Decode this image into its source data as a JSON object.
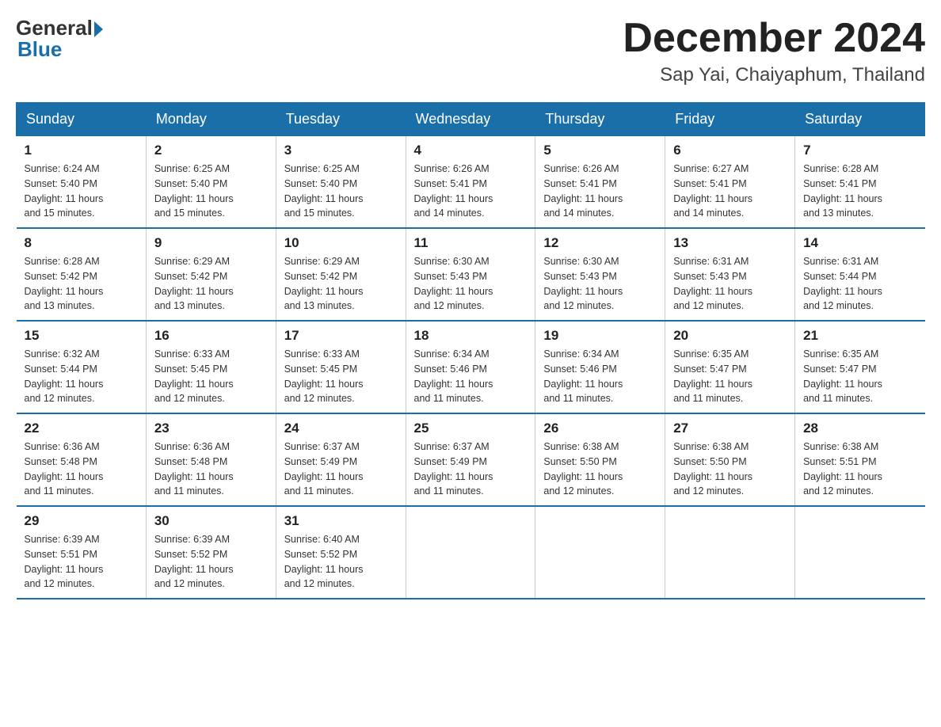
{
  "header": {
    "logo_general": "General",
    "logo_blue": "Blue",
    "month_title": "December 2024",
    "subtitle": "Sap Yai, Chaiyaphum, Thailand"
  },
  "days_of_week": [
    "Sunday",
    "Monday",
    "Tuesday",
    "Wednesday",
    "Thursday",
    "Friday",
    "Saturday"
  ],
  "weeks": [
    [
      {
        "day": "1",
        "sunrise": "6:24 AM",
        "sunset": "5:40 PM",
        "daylight": "11 hours and 15 minutes."
      },
      {
        "day": "2",
        "sunrise": "6:25 AM",
        "sunset": "5:40 PM",
        "daylight": "11 hours and 15 minutes."
      },
      {
        "day": "3",
        "sunrise": "6:25 AM",
        "sunset": "5:40 PM",
        "daylight": "11 hours and 15 minutes."
      },
      {
        "day": "4",
        "sunrise": "6:26 AM",
        "sunset": "5:41 PM",
        "daylight": "11 hours and 14 minutes."
      },
      {
        "day": "5",
        "sunrise": "6:26 AM",
        "sunset": "5:41 PM",
        "daylight": "11 hours and 14 minutes."
      },
      {
        "day": "6",
        "sunrise": "6:27 AM",
        "sunset": "5:41 PM",
        "daylight": "11 hours and 14 minutes."
      },
      {
        "day": "7",
        "sunrise": "6:28 AM",
        "sunset": "5:41 PM",
        "daylight": "11 hours and 13 minutes."
      }
    ],
    [
      {
        "day": "8",
        "sunrise": "6:28 AM",
        "sunset": "5:42 PM",
        "daylight": "11 hours and 13 minutes."
      },
      {
        "day": "9",
        "sunrise": "6:29 AM",
        "sunset": "5:42 PM",
        "daylight": "11 hours and 13 minutes."
      },
      {
        "day": "10",
        "sunrise": "6:29 AM",
        "sunset": "5:42 PM",
        "daylight": "11 hours and 13 minutes."
      },
      {
        "day": "11",
        "sunrise": "6:30 AM",
        "sunset": "5:43 PM",
        "daylight": "11 hours and 12 minutes."
      },
      {
        "day": "12",
        "sunrise": "6:30 AM",
        "sunset": "5:43 PM",
        "daylight": "11 hours and 12 minutes."
      },
      {
        "day": "13",
        "sunrise": "6:31 AM",
        "sunset": "5:43 PM",
        "daylight": "11 hours and 12 minutes."
      },
      {
        "day": "14",
        "sunrise": "6:31 AM",
        "sunset": "5:44 PM",
        "daylight": "11 hours and 12 minutes."
      }
    ],
    [
      {
        "day": "15",
        "sunrise": "6:32 AM",
        "sunset": "5:44 PM",
        "daylight": "11 hours and 12 minutes."
      },
      {
        "day": "16",
        "sunrise": "6:33 AM",
        "sunset": "5:45 PM",
        "daylight": "11 hours and 12 minutes."
      },
      {
        "day": "17",
        "sunrise": "6:33 AM",
        "sunset": "5:45 PM",
        "daylight": "11 hours and 12 minutes."
      },
      {
        "day": "18",
        "sunrise": "6:34 AM",
        "sunset": "5:46 PM",
        "daylight": "11 hours and 11 minutes."
      },
      {
        "day": "19",
        "sunrise": "6:34 AM",
        "sunset": "5:46 PM",
        "daylight": "11 hours and 11 minutes."
      },
      {
        "day": "20",
        "sunrise": "6:35 AM",
        "sunset": "5:47 PM",
        "daylight": "11 hours and 11 minutes."
      },
      {
        "day": "21",
        "sunrise": "6:35 AM",
        "sunset": "5:47 PM",
        "daylight": "11 hours and 11 minutes."
      }
    ],
    [
      {
        "day": "22",
        "sunrise": "6:36 AM",
        "sunset": "5:48 PM",
        "daylight": "11 hours and 11 minutes."
      },
      {
        "day": "23",
        "sunrise": "6:36 AM",
        "sunset": "5:48 PM",
        "daylight": "11 hours and 11 minutes."
      },
      {
        "day": "24",
        "sunrise": "6:37 AM",
        "sunset": "5:49 PM",
        "daylight": "11 hours and 11 minutes."
      },
      {
        "day": "25",
        "sunrise": "6:37 AM",
        "sunset": "5:49 PM",
        "daylight": "11 hours and 11 minutes."
      },
      {
        "day": "26",
        "sunrise": "6:38 AM",
        "sunset": "5:50 PM",
        "daylight": "11 hours and 12 minutes."
      },
      {
        "day": "27",
        "sunrise": "6:38 AM",
        "sunset": "5:50 PM",
        "daylight": "11 hours and 12 minutes."
      },
      {
        "day": "28",
        "sunrise": "6:38 AM",
        "sunset": "5:51 PM",
        "daylight": "11 hours and 12 minutes."
      }
    ],
    [
      {
        "day": "29",
        "sunrise": "6:39 AM",
        "sunset": "5:51 PM",
        "daylight": "11 hours and 12 minutes."
      },
      {
        "day": "30",
        "sunrise": "6:39 AM",
        "sunset": "5:52 PM",
        "daylight": "11 hours and 12 minutes."
      },
      {
        "day": "31",
        "sunrise": "6:40 AM",
        "sunset": "5:52 PM",
        "daylight": "11 hours and 12 minutes."
      },
      null,
      null,
      null,
      null
    ]
  ],
  "labels": {
    "sunrise": "Sunrise:",
    "sunset": "Sunset:",
    "daylight": "Daylight:"
  }
}
